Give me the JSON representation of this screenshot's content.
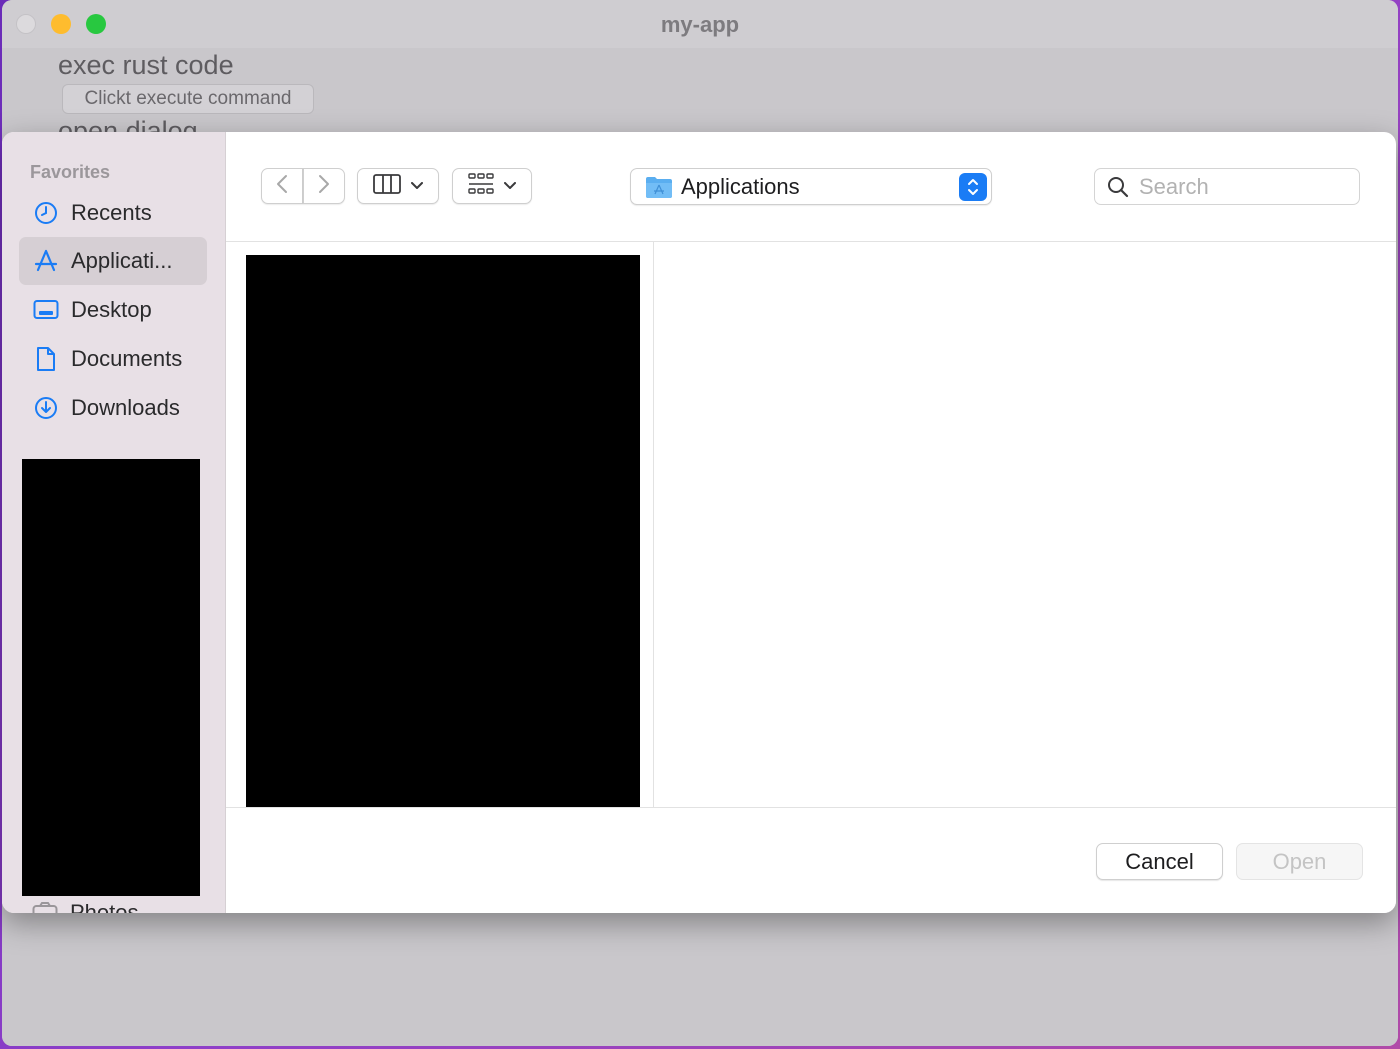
{
  "window": {
    "title": "my-app"
  },
  "app": {
    "heading": "exec rust code",
    "button_label": "Clickt execute command",
    "heading2": "open dialog"
  },
  "dialog": {
    "sidebar": {
      "section_label": "Favorites",
      "items": [
        {
          "label": "Recents",
          "icon": "clock-icon"
        },
        {
          "label": "Applicati...",
          "icon": "app-store-icon",
          "selected": true
        },
        {
          "label": "Desktop",
          "icon": "desktop-icon"
        },
        {
          "label": "Documents",
          "icon": "document-icon"
        },
        {
          "label": "Downloads",
          "icon": "download-icon"
        }
      ],
      "partial_item": {
        "label": "Photos",
        "icon": "camera-icon"
      }
    },
    "toolbar": {
      "location": "Applications",
      "search_placeholder": "Search"
    },
    "footer": {
      "cancel_label": "Cancel",
      "open_label": "Open"
    }
  },
  "colors": {
    "accent": "#1a7cf5",
    "sidebar_bg": "#e8e0e6",
    "folder_blue": "#5aaef0"
  }
}
